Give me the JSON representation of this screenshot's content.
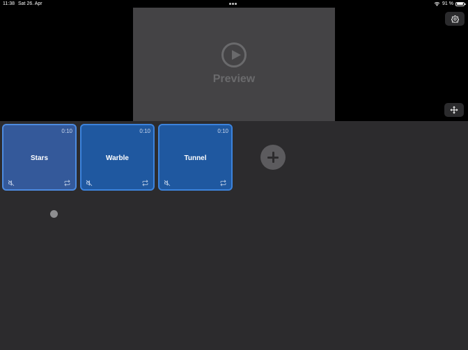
{
  "status_bar": {
    "time": "11:38",
    "date": "Sat 26. Apr",
    "battery_text": "91 %",
    "battery_level": 0.91,
    "icons": [
      "wifi-icon",
      "battery-icon",
      "multitasking-dots-icon"
    ]
  },
  "preview": {
    "label": "Preview",
    "icon": "play-circle-icon"
  },
  "toolbar": {
    "settings_icon": "gear-icon",
    "move_icon": "move-arrows-icon"
  },
  "clips": [
    {
      "title": "Stars",
      "duration": "0:10",
      "muted": true,
      "loop": true,
      "selected": true
    },
    {
      "title": "Warble",
      "duration": "0:10",
      "muted": true,
      "loop": true,
      "selected": false
    },
    {
      "title": "Tunnel",
      "duration": "0:10",
      "muted": true,
      "loop": true,
      "selected": false
    }
  ],
  "add_clip_icon": "plus-icon",
  "colors": {
    "background": "#000000",
    "timeline_background": "#2c2b2d",
    "preview_background": "#444345",
    "clip_fill": "#1f58a0",
    "clip_border": "#3c83dc",
    "selected_clip_fill": "#34599a"
  }
}
